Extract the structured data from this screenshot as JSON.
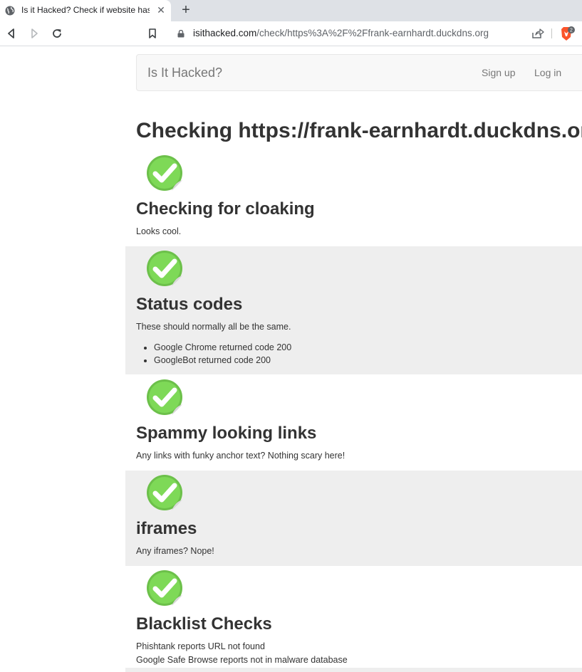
{
  "browser": {
    "tab_title": "Is it Hacked? Check if website has",
    "tab_close": "✕",
    "new_tab": "+",
    "url_host": "isithacked.com",
    "url_path": "/check/https%3A%2F%2Ffrank-earnhardt.duckdns.org",
    "shields_count": "2"
  },
  "navbar": {
    "brand": "Is It Hacked?",
    "signup": "Sign up",
    "login": "Log in"
  },
  "page_title": "Checking https://frank-earnhardt.duckdns.org",
  "sections": {
    "cloaking": {
      "title": "Checking for cloaking",
      "text": "Looks cool."
    },
    "status": {
      "title": "Status codes",
      "text": "These should normally all be the same.",
      "items": [
        "Google Chrome returned code 200",
        "GoogleBot returned code 200"
      ]
    },
    "spammy": {
      "title": "Spammy looking links",
      "text": "Any links with funky anchor text? Nothing scary here!"
    },
    "iframes": {
      "title": "iframes",
      "text": "Any iframes? Nope!"
    },
    "blacklist": {
      "title": "Blacklist Checks",
      "lines": [
        "Phishtank reports URL not found",
        "Google Safe Browse reports not in malware database"
      ]
    }
  },
  "colors": {
    "check_green": "#6cc04a",
    "shaded_bg": "#eeeeee",
    "brave_orange": "#fb542b"
  }
}
